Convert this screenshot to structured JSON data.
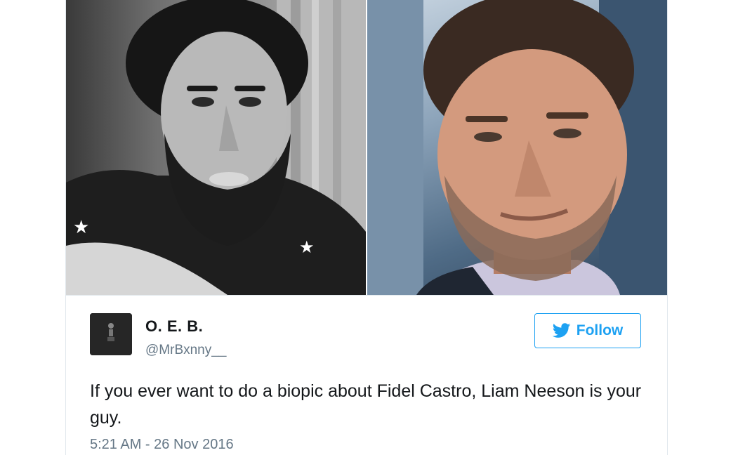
{
  "media": {
    "left_photo": {
      "description_icon": "portrait-photo",
      "tone": "#7a7a7a"
    },
    "right_photo": {
      "description_icon": "portrait-photo",
      "tone": "#5b7690"
    }
  },
  "user": {
    "name": "O. E. B.",
    "handle": "@MrBxnny__",
    "avatar_icon": "avatar-image"
  },
  "follow_button": {
    "icon": "bird-icon",
    "label": "Follow"
  },
  "tweet": {
    "text": "If you ever want to do a biopic about Fidel Castro, Liam Neeson is your guy.",
    "timestamp": "5:21 AM - 26 Nov 2016"
  },
  "colors": {
    "accent": "#1da1f2",
    "text_primary": "#14171a",
    "text_secondary": "#657786",
    "border": "#e1e8ed"
  }
}
